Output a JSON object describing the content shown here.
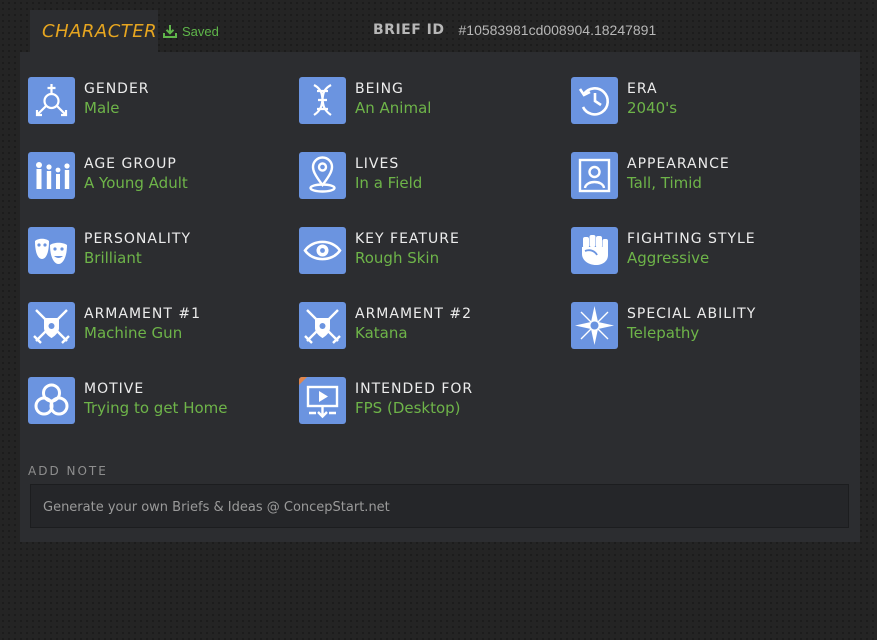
{
  "header": {
    "tab_title": "CHARACTER",
    "saved_label": "Saved",
    "brief_label": "BRIEF ID",
    "brief_id": "#10583981cd008904.18247891"
  },
  "attributes": [
    {
      "label": "GENDER",
      "value": "Male",
      "icon": "gender-icon"
    },
    {
      "label": "BEING",
      "value": "An Animal",
      "icon": "dna-icon"
    },
    {
      "label": "ERA",
      "value": "2040's",
      "icon": "history-icon"
    },
    {
      "label": "AGE GROUP",
      "value": "A Young Adult",
      "icon": "family-icon"
    },
    {
      "label": "LIVES",
      "value": "In a Field",
      "icon": "location-pin-icon"
    },
    {
      "label": "APPEARANCE",
      "value": "Tall, Timid",
      "icon": "portrait-icon"
    },
    {
      "label": "PERSONALITY",
      "value": "Brilliant",
      "icon": "theater-masks-icon"
    },
    {
      "label": "KEY FEATURE",
      "value": "Rough Skin",
      "icon": "eye-icon"
    },
    {
      "label": "FIGHTING STYLE",
      "value": "Aggressive",
      "icon": "fist-icon"
    },
    {
      "label": "ARMAMENT #1",
      "value": "Machine Gun",
      "icon": "crossed-swords-shield-icon"
    },
    {
      "label": "ARMAMENT #2",
      "value": "Katana",
      "icon": "crossed-swords-shield-icon"
    },
    {
      "label": "SPECIAL ABILITY",
      "value": "Telepathy",
      "icon": "sparkle-cross-icon"
    },
    {
      "label": "MOTIVE",
      "value": "Trying to get Home",
      "icon": "rings-icon"
    },
    {
      "label": "INTENDED FOR",
      "value": "FPS (Desktop)",
      "icon": "video-download-icon"
    }
  ],
  "note": {
    "label": "ADD NOTE",
    "placeholder": "Generate your own Briefs & Ideas @ ConcepStart.net"
  },
  "colors": {
    "accent_orange": "#e6a520",
    "value_green": "#6eb449",
    "icon_blue": "#6b94e0",
    "panel": "#2c2d30"
  }
}
